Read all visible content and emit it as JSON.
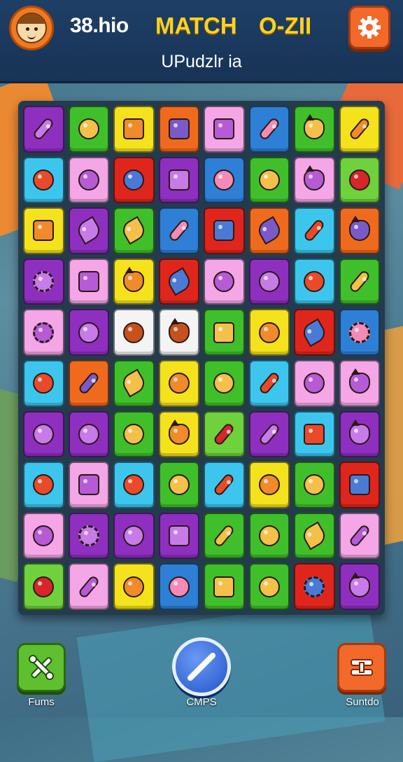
{
  "header": {
    "score_text": "38.hio",
    "title_left": "MATCH",
    "title_right": "O-ZII",
    "subtitle": "UPudzlr ia"
  },
  "colors": {
    "header_bg": "#1f3f66",
    "title": "#ffd21f",
    "purple": "#8e2fc0",
    "green": "#3fbf2a",
    "yellow": "#f4e21c",
    "orange": "#f06a1e",
    "pink": "#f4a6e6",
    "blue": "#2e7fd6",
    "red": "#e0261c",
    "cyan": "#3cc6ee",
    "lime": "#6fd13c",
    "white": "#f4f4f4"
  },
  "board": {
    "rows": [
      [
        {
          "c": "purple",
          "i": "stick-icon"
        },
        {
          "c": "green",
          "i": "muffin-icon"
        },
        {
          "c": "yellow",
          "i": "box-icon"
        },
        {
          "c": "orange",
          "i": "cabinet-icon"
        },
        {
          "c": "pink",
          "i": "jar-icon"
        },
        {
          "c": "blue",
          "i": "crayon-icon"
        },
        {
          "c": "green",
          "i": "cat-face-icon"
        },
        {
          "c": "yellow",
          "i": "carrot-icon"
        }
      ],
      [
        {
          "c": "cyan",
          "i": "tomato-icon"
        },
        {
          "c": "pink",
          "i": "plum-icon"
        },
        {
          "c": "red",
          "i": "eye-icon"
        },
        {
          "c": "purple",
          "i": "toaster-icon"
        },
        {
          "c": "blue",
          "i": "corn-icon"
        },
        {
          "c": "green",
          "i": "face-icon"
        },
        {
          "c": "pink",
          "i": "cat-face-icon"
        },
        {
          "c": "lime",
          "i": "apple-icon"
        }
      ],
      [
        {
          "c": "yellow",
          "i": "crate-icon"
        },
        {
          "c": "purple",
          "i": "fish-icon"
        },
        {
          "c": "green",
          "i": "shell-icon"
        },
        {
          "c": "blue",
          "i": "brush-icon"
        },
        {
          "c": "red",
          "i": "picture-icon"
        },
        {
          "c": "orange",
          "i": "drop-icon"
        },
        {
          "c": "cyan",
          "i": "carrot-icon"
        },
        {
          "c": "orange",
          "i": "dog-face-icon"
        }
      ],
      [
        {
          "c": "purple",
          "i": "sun-icon"
        },
        {
          "c": "pink",
          "i": "cup-icon"
        },
        {
          "c": "yellow",
          "i": "critter-icon"
        },
        {
          "c": "red",
          "i": "leaf-icon"
        },
        {
          "c": "pink",
          "i": "eggplant-icon"
        },
        {
          "c": "purple",
          "i": "spiral-icon"
        },
        {
          "c": "cyan",
          "i": "orange-icon"
        },
        {
          "c": "green",
          "i": "carrot-icon"
        }
      ],
      [
        {
          "c": "pink",
          "i": "flower-icon"
        },
        {
          "c": "purple",
          "i": "onion-icon"
        },
        {
          "c": "white",
          "i": "bread-icon"
        },
        {
          "c": "white",
          "i": "cat-face-icon"
        },
        {
          "c": "green",
          "i": "book-icon"
        },
        {
          "c": "yellow",
          "i": "radish-icon"
        },
        {
          "c": "red",
          "i": "leaf-icon"
        },
        {
          "c": "blue",
          "i": "gear-icon"
        }
      ],
      [
        {
          "c": "cyan",
          "i": "pumpkin-icon"
        },
        {
          "c": "orange",
          "i": "stick-icon"
        },
        {
          "c": "green",
          "i": "leaf-icon"
        },
        {
          "c": "yellow",
          "i": "grape-icon"
        },
        {
          "c": "green",
          "i": "beetle-icon"
        },
        {
          "c": "cyan",
          "i": "pencil-icon"
        },
        {
          "c": "pink",
          "i": "cherry-icon"
        },
        {
          "c": "pink",
          "i": "cat-face-icon"
        }
      ],
      [
        {
          "c": "purple",
          "i": "mushroom-icon"
        },
        {
          "c": "purple",
          "i": "donut-icon"
        },
        {
          "c": "green",
          "i": "berry-icon"
        },
        {
          "c": "yellow",
          "i": "monster-icon"
        },
        {
          "c": "lime",
          "i": "crayon-icon"
        },
        {
          "c": "purple",
          "i": "marker-icon"
        },
        {
          "c": "cyan",
          "i": "bag-icon"
        },
        {
          "c": "purple",
          "i": "frog-icon"
        }
      ],
      [
        {
          "c": "cyan",
          "i": "pineapple-icon"
        },
        {
          "c": "pink",
          "i": "stack-icon"
        },
        {
          "c": "cyan",
          "i": "bowl-icon"
        },
        {
          "c": "green",
          "i": "tomato-icon"
        },
        {
          "c": "cyan",
          "i": "bone-icon"
        },
        {
          "c": "yellow",
          "i": "ghost-icon"
        },
        {
          "c": "green",
          "i": "orange-icon"
        },
        {
          "c": "red",
          "i": "chest-icon"
        }
      ],
      [
        {
          "c": "pink",
          "i": "lemon-icon"
        },
        {
          "c": "purple",
          "i": "sun-icon"
        },
        {
          "c": "purple",
          "i": "lime-icon"
        },
        {
          "c": "purple",
          "i": "jar-icon"
        },
        {
          "c": "green",
          "i": "brush-icon"
        },
        {
          "c": "green",
          "i": "eggplant-icon"
        },
        {
          "c": "green",
          "i": "leaf-icon"
        },
        {
          "c": "pink",
          "i": "carrot-icon"
        }
      ],
      [
        {
          "c": "lime",
          "i": "plum-icon"
        },
        {
          "c": "pink",
          "i": "tube-icon"
        },
        {
          "c": "yellow",
          "i": "radish-icon"
        },
        {
          "c": "blue",
          "i": "beet-icon"
        },
        {
          "c": "green",
          "i": "stack-icon"
        },
        {
          "c": "green",
          "i": "strawberry-icon"
        },
        {
          "c": "red",
          "i": "sun-icon"
        },
        {
          "c": "purple",
          "i": "cat-face-icon"
        }
      ]
    ]
  },
  "bottom": {
    "left_label": "Fums",
    "center_label": "CMPS",
    "right_label": "Suntdo"
  }
}
